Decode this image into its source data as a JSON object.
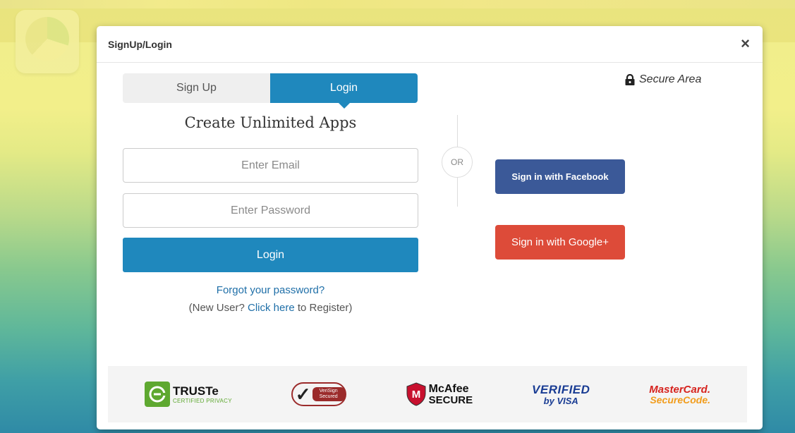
{
  "modal": {
    "title": "SignUp/Login",
    "close_label": "×",
    "secure_label": "Secure Area"
  },
  "tabs": [
    {
      "label": "Sign Up",
      "active": false
    },
    {
      "label": "Login",
      "active": true
    }
  ],
  "form": {
    "heading": "Create Unlimited Apps",
    "email_placeholder": "Enter Email",
    "email_value": "",
    "password_placeholder": "Enter Password",
    "password_value": "",
    "login_label": "Login",
    "forgot_label": "Forgot your password?",
    "new_user_prefix": "(New User?",
    "click_here_label": "Click here",
    "new_user_suffix": "to Register)"
  },
  "divider": {
    "or_label": "OR"
  },
  "social": {
    "facebook_label": "Sign in with Facebook",
    "google_label": "Sign in with Google+"
  },
  "trust_badges": {
    "truste_name": "TRUSTe",
    "truste_sub": "CERTIFIED PRIVACY",
    "verisign_label": "VeriSign Secured",
    "mcafee_name": "McAfee",
    "mcafee_sub": "SECURE",
    "visa_verified": "VERIFIED",
    "visa_by": "by VISA",
    "mastercard_name": "MasterCard.",
    "mastercard_code": "SecureCode."
  },
  "colors": {
    "primary": "#1f88bd",
    "facebook": "#3b5998",
    "google": "#dd4b39",
    "link": "#1f6fa8"
  },
  "icons": {
    "close": "close-icon",
    "lock": "lock-icon",
    "app_logo": "app-logo-icon"
  }
}
